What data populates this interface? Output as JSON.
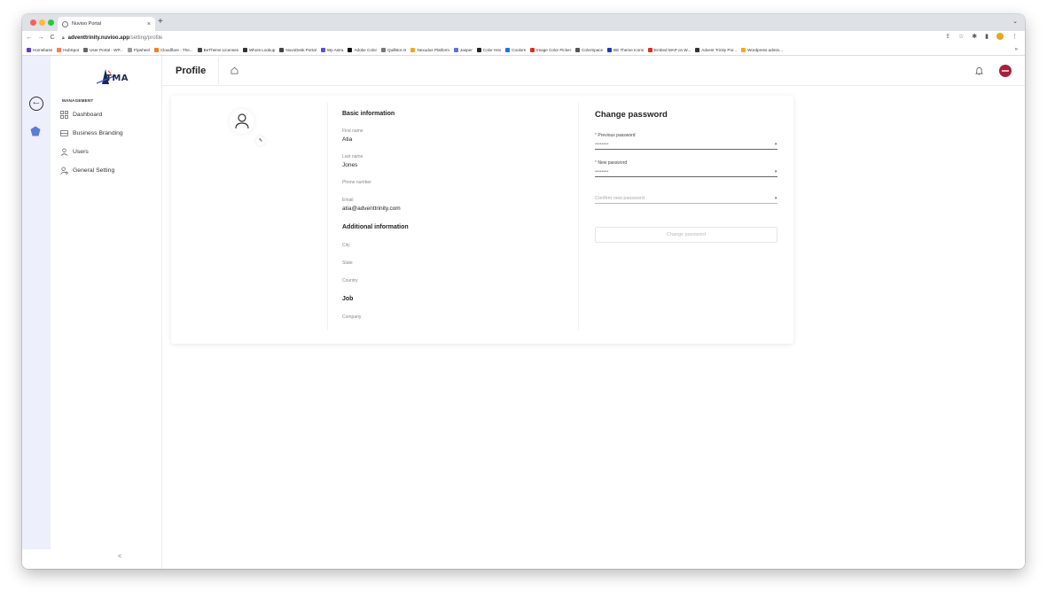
{
  "browser": {
    "tab_title": "Nuvioo Portal",
    "tab_close": "×",
    "new_tab": "+",
    "tab_menu": "⌄",
    "url_host": "adventtrinity.nuvioo.app",
    "url_path": "/setting/profile",
    "bookmarks": [
      {
        "label": "Homebase",
        "color": "#5c3bd8"
      },
      {
        "label": "HubSpot",
        "color": "#ff7a59"
      },
      {
        "label": "User Portal - WP...",
        "color": "#666666"
      },
      {
        "label": "Flywheel",
        "color": "#999999"
      },
      {
        "label": "Cloudflare - The...",
        "color": "#f38020"
      },
      {
        "label": "BeTheme Licenses",
        "color": "#444444"
      },
      {
        "label": "WhoIs Lookup",
        "color": "#333333"
      },
      {
        "label": "NuvoDesk Portal",
        "color": "#444444"
      },
      {
        "label": "Wp Astra",
        "color": "#5b4fcf"
      },
      {
        "label": "Adobe Color",
        "color": "#111111"
      },
      {
        "label": "QuillBot AI",
        "color": "#777777"
      },
      {
        "label": "Nexudus Platform",
        "color": "#f5a623"
      },
      {
        "label": "Jasper",
        "color": "#5f6fe0"
      },
      {
        "label": "Color Hex",
        "color": "#222222"
      },
      {
        "label": "Coolors",
        "color": "#1a73e8"
      },
      {
        "label": "Image Color Picker",
        "color": "#d93025"
      },
      {
        "label": "ColorSpace",
        "color": "#555555"
      },
      {
        "label": "BE Theme Icons",
        "color": "#1a3bb5"
      },
      {
        "label": "Embed MAP on W...",
        "color": "#d93025"
      },
      {
        "label": "Advent Trinity Por...",
        "color": "#333333"
      },
      {
        "label": "Wordpress admin...",
        "color": "#f5a623"
      }
    ],
    "bookmarks_more": "»"
  },
  "sidebar": {
    "logo_text": "TMA",
    "section_title": "MANAGEMENT",
    "items": [
      {
        "label": "Dashboard"
      },
      {
        "label": "Business Branding"
      },
      {
        "label": "Users"
      },
      {
        "label": "General Setting"
      }
    ],
    "collapse_label": "<"
  },
  "header": {
    "title": "Profile",
    "avatar_color": "#a5223b"
  },
  "profile": {
    "basic_title": "Basic information",
    "first_name_label": "First name",
    "first_name": "Atia",
    "last_name_label": "Last name",
    "last_name": "Jones",
    "phone_label": "Phone number",
    "email_label": "Email",
    "email": "atia@adventtrinity.com",
    "additional_title": "Additional information",
    "city_label": "City",
    "state_label": "State",
    "country_label": "Country",
    "job_title": "Job",
    "company_label": "Company"
  },
  "change_password": {
    "title": "Change password",
    "required_mark": "*",
    "previous_label": "Previous password",
    "previous_value": "••••••••",
    "new_label": "New password",
    "new_value": "••••••••",
    "confirm_placeholder": "Confirm new password",
    "button_label": "Change password"
  }
}
